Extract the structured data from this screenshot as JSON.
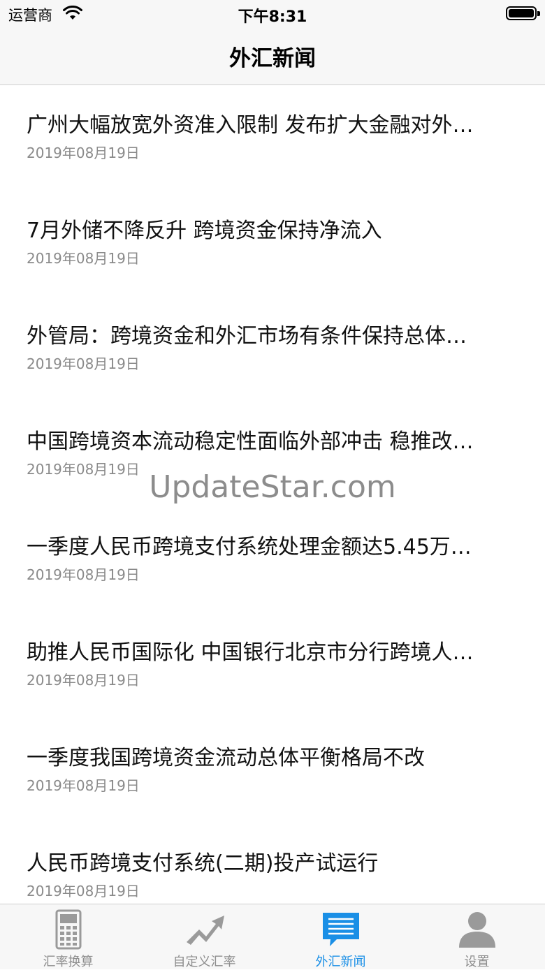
{
  "status_bar": {
    "carrier": "运营商",
    "time": "下午8:31"
  },
  "nav": {
    "title": "外汇新闻"
  },
  "news": [
    {
      "title": "广州大幅放宽外资准入限制 发布扩大金融对外…",
      "date": "2019年08月19日"
    },
    {
      "title": "7月外储不降反升 跨境资金保持净流入",
      "date": "2019年08月19日"
    },
    {
      "title": "外管局：跨境资金和外汇市场有条件保持总体…",
      "date": "2019年08月19日"
    },
    {
      "title": "中国跨境资本流动稳定性面临外部冲击 稳推改…",
      "date": "2019年08月19日"
    },
    {
      "title": "一季度人民币跨境支付系统处理金额达5.45万…",
      "date": "2019年08月19日"
    },
    {
      "title": "助推人民币国际化 中国银行北京市分行跨境人…",
      "date": "2019年08月19日"
    },
    {
      "title": "一季度我国跨境资金流动总体平衡格局不改",
      "date": "2019年08月19日"
    },
    {
      "title": "人民币跨境支付系统(二期)投产试运行",
      "date": "2019年08月19日"
    }
  ],
  "watermark": "UpdateStar.com",
  "tabs": [
    {
      "label": "汇率换算",
      "icon": "calculator-icon",
      "active": false
    },
    {
      "label": "自定义汇率",
      "icon": "trend-arrow-icon",
      "active": false
    },
    {
      "label": "外汇新闻",
      "icon": "news-message-icon",
      "active": true
    },
    {
      "label": "设置",
      "icon": "user-icon",
      "active": false
    }
  ],
  "colors": {
    "accent": "#1a8fe6",
    "inactive": "#8e8e8e",
    "bar_bg": "#f7f7f7"
  }
}
